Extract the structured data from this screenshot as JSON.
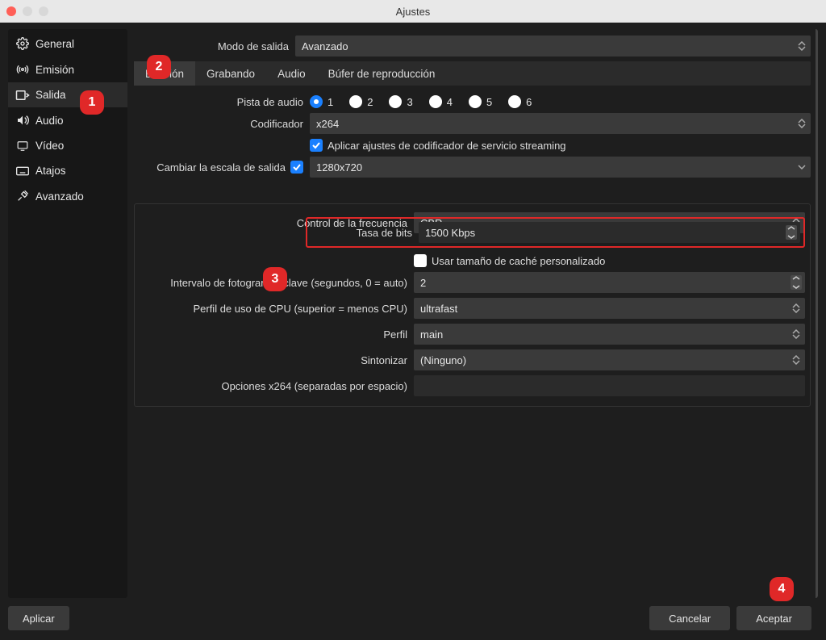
{
  "window": {
    "title": "Ajustes"
  },
  "sidebar": {
    "items": [
      {
        "label": "General",
        "id": "general",
        "icon": "gear"
      },
      {
        "label": "Emisión",
        "id": "emision",
        "icon": "antenna"
      },
      {
        "label": "Salida",
        "id": "salida",
        "icon": "output"
      },
      {
        "label": "Audio",
        "id": "audio",
        "icon": "speaker"
      },
      {
        "label": "Vídeo",
        "id": "video",
        "icon": "monitor"
      },
      {
        "label": "Atajos",
        "id": "atajos",
        "icon": "keyboard"
      },
      {
        "label": "Avanzado",
        "id": "avanzado",
        "icon": "tools"
      }
    ],
    "selected": "salida"
  },
  "outputMode": {
    "label": "Modo de salida",
    "value": "Avanzado"
  },
  "tabs": {
    "items": [
      "Emisión",
      "Grabando",
      "Audio",
      "Búfer de reproducción"
    ],
    "selected": 0
  },
  "audioTrack": {
    "label": "Pista de audio",
    "options": [
      "1",
      "2",
      "3",
      "4",
      "5",
      "6"
    ],
    "selected": "1"
  },
  "encoder": {
    "label": "Codificador",
    "value": "x264"
  },
  "enforceStreaming": {
    "checked": true,
    "label": "Aplicar ajustes de codificador de servicio streaming"
  },
  "rescale": {
    "label": "Cambiar la escala de salida",
    "checked": true,
    "value": "1280x720"
  },
  "rateControl": {
    "label": "Control de la frecuencia",
    "value": "CBR"
  },
  "bitrate": {
    "label": "Tasa de bits",
    "value": "1500 Kbps"
  },
  "customBuffer": {
    "checked": false,
    "label": "Usar tamaño de caché personalizado"
  },
  "keyframe": {
    "label": "Intervalo de fotogramas clave (segundos, 0 = auto)",
    "value": "2"
  },
  "cpuPreset": {
    "label": "Perfil de uso de CPU (superior = menos CPU)",
    "value": "ultrafast"
  },
  "profile": {
    "label": "Perfil",
    "value": "main"
  },
  "tune": {
    "label": "Sintonizar",
    "value": "(Ninguno)"
  },
  "x264opts": {
    "label": "Opciones x264 (separadas por espacio)",
    "value": ""
  },
  "buttons": {
    "apply": "Aplicar",
    "cancel": "Cancelar",
    "ok": "Aceptar"
  },
  "markers": {
    "m1": "1",
    "m2": "2",
    "m3": "3",
    "m4": "4"
  }
}
